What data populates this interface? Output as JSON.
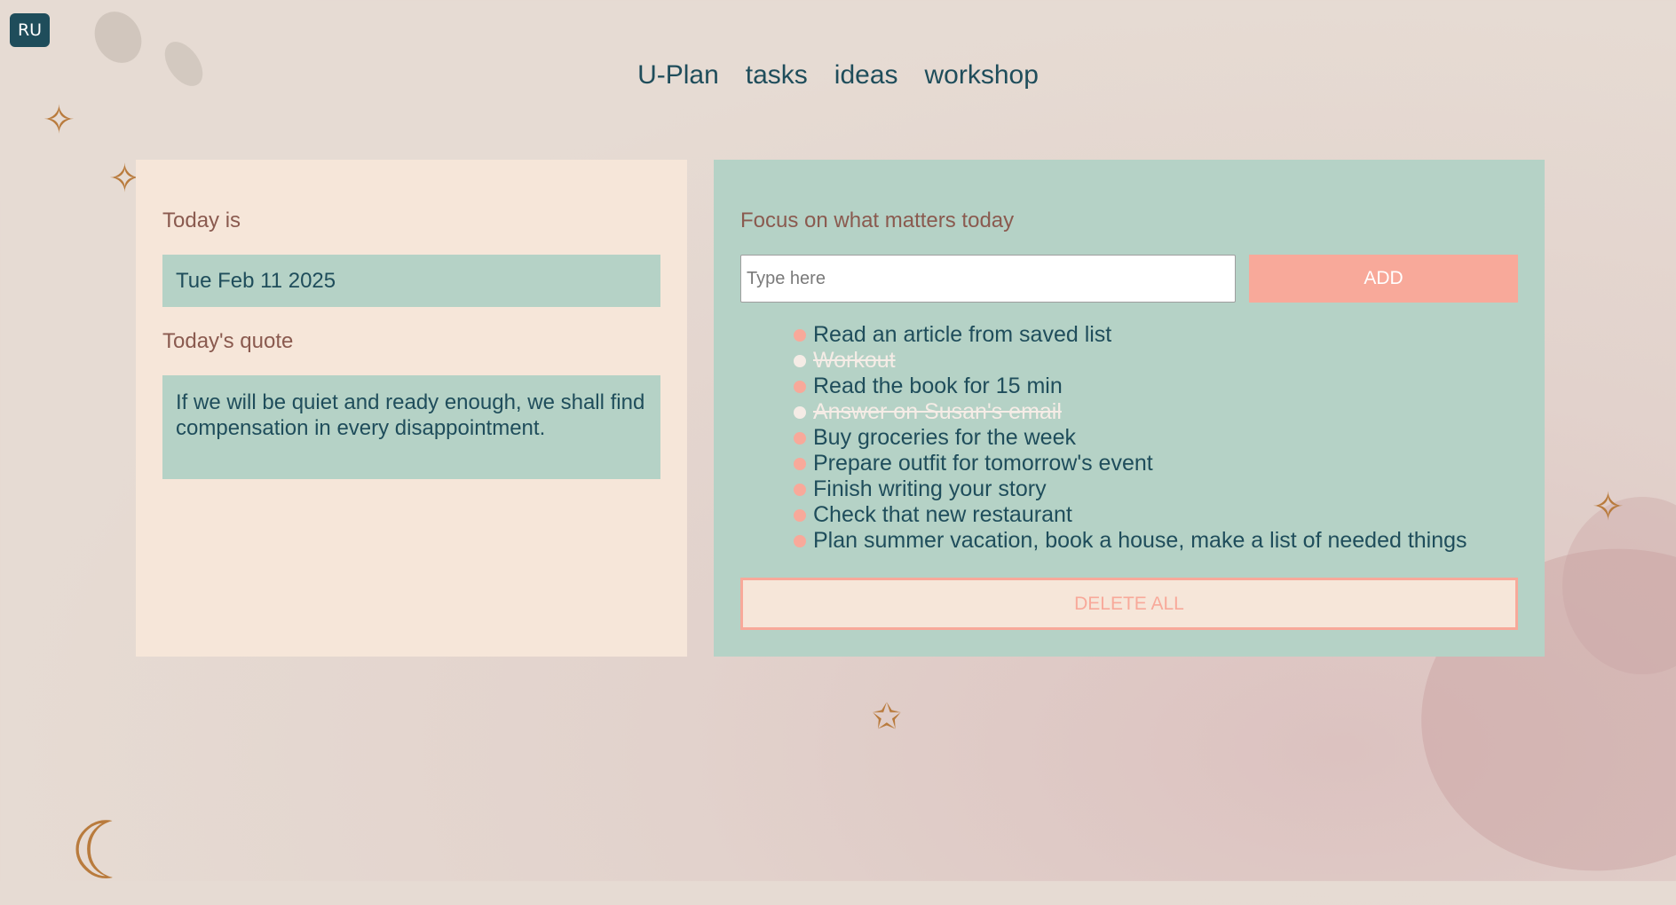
{
  "lang_button": "RU",
  "nav": {
    "items": [
      "U-Plan",
      "tasks",
      "ideas",
      "workshop"
    ]
  },
  "today": {
    "label": "Today is",
    "date": "Tue Feb 11 2025",
    "quote_label": "Today's quote",
    "quote": "If we will be quiet and ready enough, we shall find compensation in every disappointment."
  },
  "focus": {
    "title": "Focus on what matters today",
    "input_placeholder": "Type here",
    "add_label": "ADD",
    "delete_label": "DELETE ALL",
    "tasks": [
      {
        "text": "Read an article from saved list",
        "done": false
      },
      {
        "text": "Workout",
        "done": true
      },
      {
        "text": "Read the book for 15 min",
        "done": false
      },
      {
        "text": "Answer on Susan's email",
        "done": true
      },
      {
        "text": "Buy groceries for the week",
        "done": false
      },
      {
        "text": "Prepare outfit for tomorrow's event",
        "done": false
      },
      {
        "text": "Finish writing your story",
        "done": false
      },
      {
        "text": "Check that new restaurant",
        "done": false
      },
      {
        "text": "Plan summer vacation, book a house, make a list of needed things",
        "done": false
      }
    ]
  },
  "colors": {
    "accent_dark": "#1f4d5b",
    "mint": "#b5d2c6",
    "peach": "#f6e6d9",
    "salmon": "#f8a99a",
    "brown_text": "#8a5a4f"
  }
}
